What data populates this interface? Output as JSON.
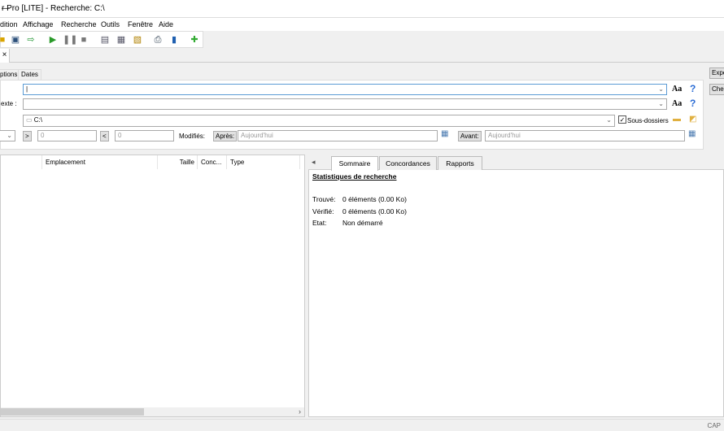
{
  "window": {
    "title": "r Pro [LITE] - Recherche: C:\\",
    "minimize": "—"
  },
  "menu": [
    "dition",
    "Affichage",
    "Recherche",
    "Outils",
    "Fenêtre",
    "Aide"
  ],
  "doc_tab": {
    "close": "×"
  },
  "option_tabs": [
    "ptions",
    "Dates"
  ],
  "side_buttons": [
    "Expe",
    "Cher"
  ],
  "search": {
    "row1": {
      "value": "|",
      "case": "Aa",
      "help": "?"
    },
    "row2": {
      "label": "exte :",
      "value": "",
      "case": "Aa",
      "help": "?"
    },
    "row3": {
      "value": "C:\\",
      "subfolders_label": "Sous-dossiers",
      "subfolders_checked": true
    },
    "row4": {
      "gt": ">",
      "gt_value": "0",
      "lt": "<",
      "lt_value": "0",
      "modified_label": "Modifiés:",
      "after_label": "Après:",
      "after_placeholder": "Aujourd'hui",
      "before_label": "Avant:",
      "before_placeholder": "Aujourd'hui"
    }
  },
  "results": {
    "columns": [
      "Emplacement",
      "Taille",
      "Conc...",
      "Type"
    ],
    "scroll_right": "›"
  },
  "right": {
    "tabs": [
      "Sommaire",
      "Concordances",
      "Rapports"
    ],
    "tab_arrow": "◂",
    "stats_title": "Statistiques de recherche",
    "stats": [
      {
        "label": "Trouvé:",
        "value": "0 éléments (0.00 Ko)"
      },
      {
        "label": "Vérifié:",
        "value": "0 éléments (0.00 Ko)"
      },
      {
        "label": "Etat:",
        "value": "Non démarré"
      }
    ]
  },
  "status": {
    "cap": "CAP"
  }
}
